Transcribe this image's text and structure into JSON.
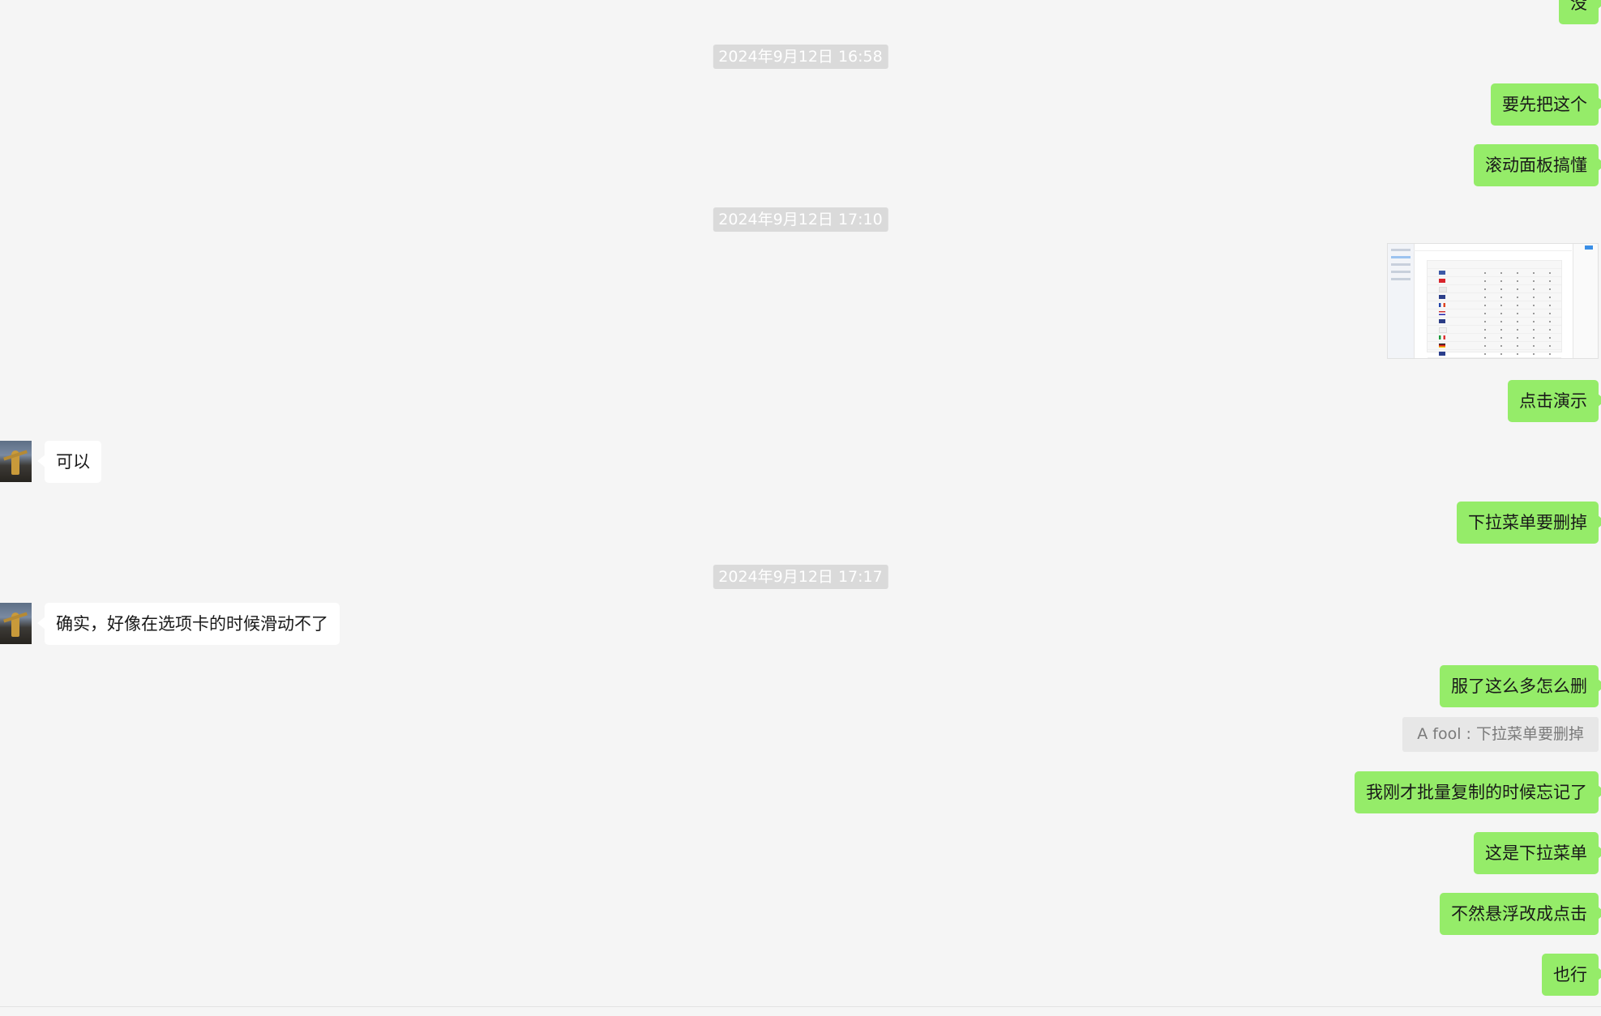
{
  "timestamps": [
    "2024年9月12日 16:58",
    "2024年9月12日 17:10",
    "2024年9月12日 17:17"
  ],
  "messages": {
    "m0": "没",
    "m1": "要先把这个",
    "m2": "滚动面板搞懂",
    "m3": "点击演示",
    "m4": "可以",
    "m5": "下拉菜单要删掉",
    "m6": "确实，好像在选项卡的时候滑动不了",
    "m7": "服了这么多怎么删",
    "m8_quote": "A fool : 下拉菜单要删掉",
    "m9": "我刚才批量复制的时候忘记了",
    "m10": "这是下拉菜单",
    "m11": "不然悬浮改成点击",
    "m12": "也行"
  },
  "colors": {
    "background": "#f5f5f5",
    "my_bubble": "#95ec69",
    "their_bubble": "#ffffff",
    "timestamp_bg": "#dadada",
    "quote_bg": "#e7e7e7"
  },
  "icons": {
    "avatar": "avatar-photo",
    "image": "screenshot-thumbnail"
  }
}
